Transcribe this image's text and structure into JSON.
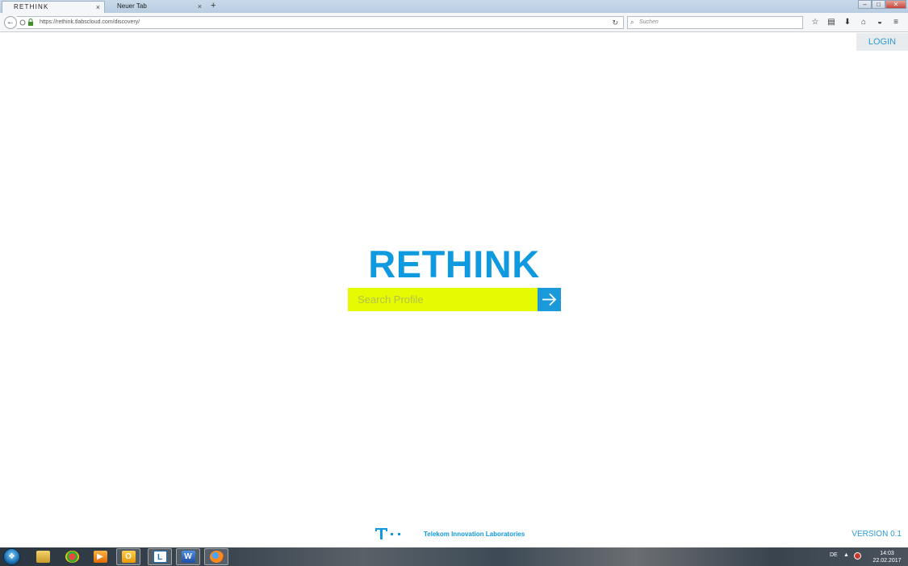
{
  "browser": {
    "tabs": [
      {
        "label": "RETHINK",
        "active": true
      },
      {
        "label": "Neuer Tab",
        "active": false
      }
    ],
    "new_tab_label": "+",
    "tab_close_label": "×",
    "window_controls": {
      "minimize": "–",
      "maximize": "□",
      "close": "✕"
    },
    "back_label": "←",
    "url": "https://rethink.tlabscloud.com/discovery/",
    "search_placeholder": "Suchen",
    "toolbar_icons": [
      "star-icon",
      "reading-list-icon",
      "download-icon",
      "home-icon",
      "pocket-icon",
      "menu-icon"
    ]
  },
  "page": {
    "login_label": "LOGIN",
    "title": "RETHINK",
    "search_placeholder": "Search Profile",
    "footer_text": "Telekom Innovation Laboratories",
    "version": "VERSION 0.1"
  },
  "colors": {
    "brand_blue": "#0f9ae0",
    "search_yellow": "#e6fa00",
    "button_blue": "#1a9ad8",
    "telekom_logo": "#0f9ae0"
  },
  "taskbar": {
    "apps": [
      "windows-explorer-icon",
      "paint-icon",
      "media-player-icon",
      "outlook-icon",
      "lync-icon",
      "word-icon",
      "firefox-icon"
    ],
    "language": "DE",
    "time": "14:03",
    "date": "22.02.2017"
  }
}
